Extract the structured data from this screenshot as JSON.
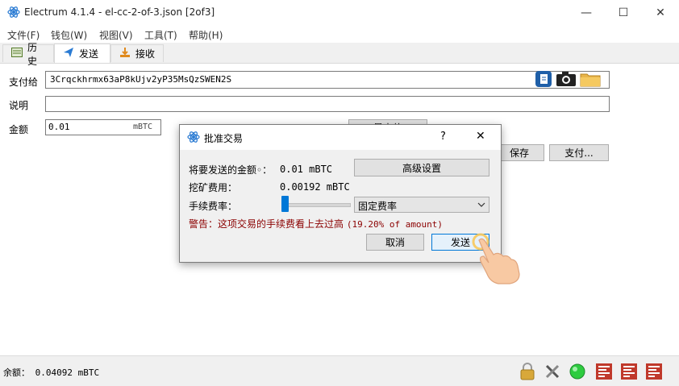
{
  "window": {
    "title": "Electrum 4.1.4  -  el-cc-2-of-3.json  [2of3]",
    "controls": {
      "minimize": "—",
      "maximize": "☐",
      "close": "✕"
    }
  },
  "menu": [
    "文件(F)",
    "钱包(W)",
    "视图(V)",
    "工具(T)",
    "帮助(H)"
  ],
  "tabs": [
    {
      "label": "历史",
      "icon": "history-icon"
    },
    {
      "label": "发送",
      "icon": "send-icon"
    },
    {
      "label": "接收",
      "icon": "receive-icon"
    }
  ],
  "send_form": {
    "pay_to_label": "支付给",
    "pay_to_value": "3Crqckhrmx63aP8kUjv2yP35MsQzSWEN2S",
    "description_label": "说明",
    "description_value": "",
    "amount_label": "金额",
    "amount_value": "0.01",
    "amount_unit": "mBTC",
    "max_button": "最大值",
    "save_button": "保存",
    "pay_button": "支付..."
  },
  "dialog": {
    "title": "批准交易",
    "help": "?",
    "close": "✕",
    "amount_label": "将要发送的金额◦：",
    "amount_value": "0.01 mBTC",
    "advanced_button": "高级设置",
    "mining_fee_label": "挖矿费用：",
    "mining_fee_value": "0.00192 mBTC",
    "fee_rate_label": "手续费率：",
    "fee_slider_level": 0,
    "fee_mode": "固定费率",
    "warning_prefix": "警告：这项交易的手续费看上去过高",
    "warning_detail": "(19.20% of amount)",
    "cancel_button": "取消",
    "send_button": "发送"
  },
  "status": {
    "balance": "余额： 0.04092 mBTC"
  },
  "colors": {
    "accent": "#0078d7",
    "warning": "#8b0000",
    "status_green": "#2ecc40",
    "seed_red": "#c0392b"
  }
}
